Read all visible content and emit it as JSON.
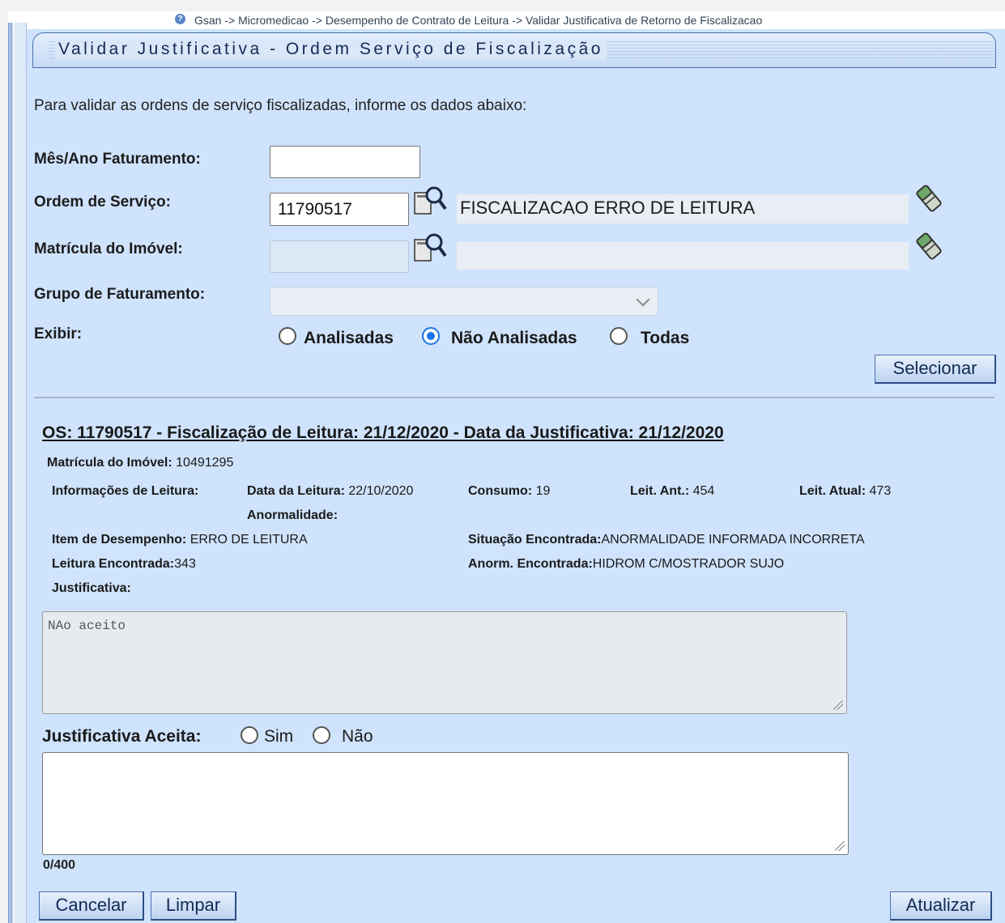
{
  "breadcrumb": "Gsan -> Micromedicao -> Desempenho de Contrato de Leitura -> Validar Justificativa de Retorno de Fiscalizacao",
  "page_title": "Validar Justificativa - Ordem Serviço de Fiscalização",
  "intro_text": "Para validar as ordens de serviço fiscalizadas, informe os dados abaixo:",
  "form": {
    "mes_ano_label": "Mês/Ano Faturamento:",
    "mes_ano_value": "",
    "ordem_label": "Ordem de Serviço:",
    "ordem_value": "11790517",
    "ordem_desc": "FISCALIZACAO ERRO DE LEITURA",
    "matricula_label": "Matrícula do Imóvel:",
    "matricula_value": "",
    "matricula_desc": "",
    "grupo_label": "Grupo de Faturamento:",
    "grupo_value": "",
    "exibir_label": "Exibir:",
    "exibir_options": [
      "Analisadas",
      "Não Analisadas",
      "Todas"
    ],
    "exibir_selected": "Não Analisadas",
    "selecionar_label": "Selecionar"
  },
  "detail": {
    "heading": "OS: 11790517 - Fiscalização de Leitura: 21/12/2020 - Data da Justificativa: 21/12/2020",
    "matricula_label": "Matrícula do Imóvel:",
    "matricula_value": "10491295",
    "info_leitura_label": "Informações de Leitura:",
    "data_leitura_label": "Data da Leitura:",
    "data_leitura_value": "22/10/2020",
    "consumo_label": "Consumo:",
    "consumo_value": "19",
    "leit_ant_label": "Leit. Ant.:",
    "leit_ant_value": "454",
    "leit_atual_label": "Leit. Atual:",
    "leit_atual_value": "473",
    "anormalidade_label": "Anormalidade:",
    "item_desempenho_label": "Item de Desempenho:",
    "item_desempenho_value": "ERRO DE LEITURA",
    "situacao_label": "Situação Encontrada:",
    "situacao_value": "ANORMALIDADE INFORMADA INCORRETA",
    "leitura_encontrada_label": "Leitura Encontrada:",
    "leitura_encontrada_value": "343",
    "anorm_encontrada_label": "Anorm. Encontrada:",
    "anorm_encontrada_value": "HIDROM C/MOSTRADOR SUJO",
    "justificativa_label": "Justificativa:",
    "justificativa_text": "NAo aceito",
    "aceita_label": "Justificativa Aceita:",
    "aceita_options": [
      "Sim",
      "Não"
    ],
    "resposta_value": "",
    "char_counter": "0/400"
  },
  "buttons": {
    "cancelar": "Cancelar",
    "limpar": "Limpar",
    "atualizar": "Atualizar"
  },
  "icons": [
    "help-icon",
    "lookup-magnifier-icon",
    "eraser-icon",
    "chevron-down-icon"
  ]
}
